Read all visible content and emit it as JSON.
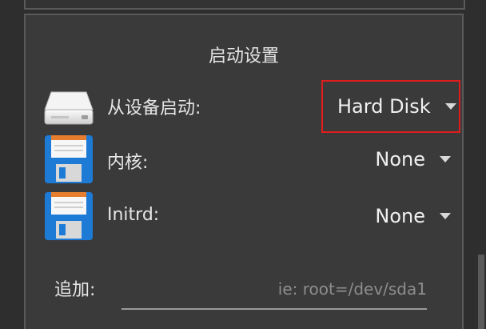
{
  "dialog": {
    "title": "启动设置",
    "rows": [
      {
        "label": "从设备启动:",
        "value": "Hard Disk",
        "icon": "hard-disk-icon"
      },
      {
        "label": "内核:",
        "value": "None",
        "icon": "floppy-disk-icon"
      },
      {
        "label": "Initrd:",
        "value": "None",
        "icon": "floppy-disk-icon"
      }
    ],
    "append": {
      "label": "追加:",
      "value": "",
      "placeholder": "ie: root=/dev/sda1"
    }
  },
  "colors": {
    "background": "#2e2e2e",
    "dialog": "#3a3a3a",
    "highlight": "#e01d1d",
    "floppy_blue": "#1d7bd6",
    "label_white": "#f2f2f2"
  }
}
